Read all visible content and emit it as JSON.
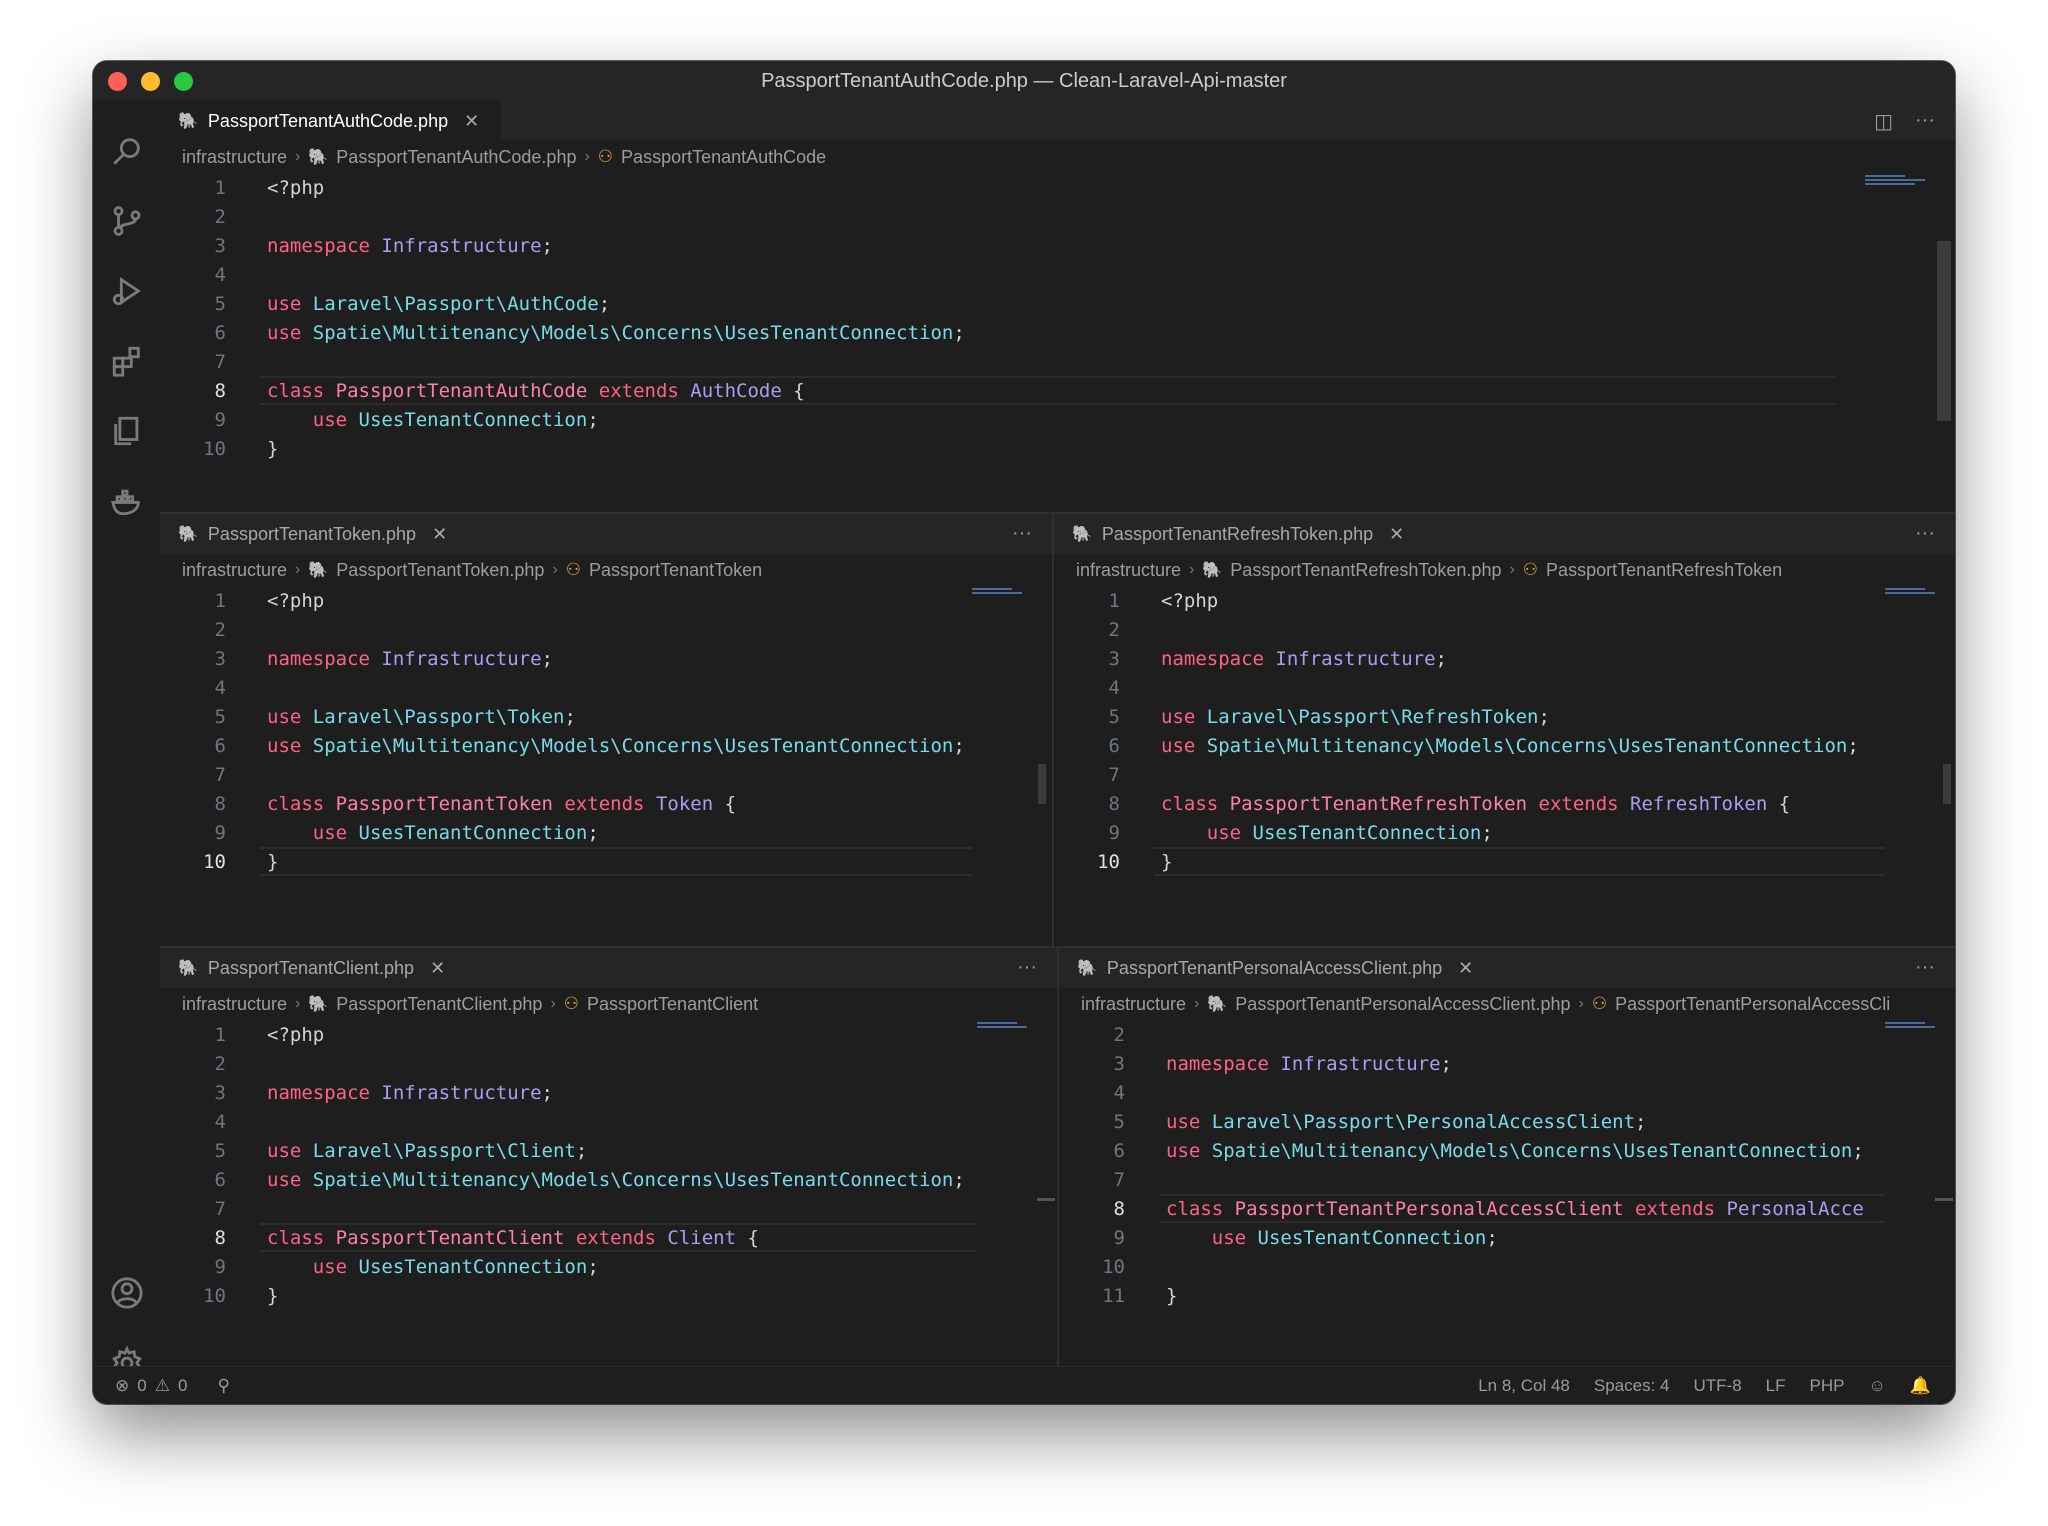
{
  "window": {
    "title": "PassportTenantAuthCode.php — Clean-Laravel-Api-master"
  },
  "activity_bar": [
    "search-icon",
    "source-control-icon",
    "run-debug-icon",
    "extensions-icon",
    "explorer-icon",
    "docker-icon",
    "account-icon",
    "settings-gear-icon"
  ],
  "panes": [
    {
      "id": "top",
      "tab": "PassportTenantAuthCode.php",
      "breadcrumb": {
        "folder": "infrastructure",
        "file": "PassportTenantAuthCode.php",
        "symbol": "PassportTenantAuthCode"
      },
      "lines": [
        {
          "n": "1",
          "tokens": [
            [
              "plain",
              "<?php"
            ]
          ]
        },
        {
          "n": "2",
          "tokens": []
        },
        {
          "n": "3",
          "tokens": [
            [
              "kw",
              "namespace "
            ],
            [
              "ns",
              "Infrastructure"
            ],
            [
              "plain",
              ";"
            ]
          ]
        },
        {
          "n": "4",
          "tokens": []
        },
        {
          "n": "5",
          "tokens": [
            [
              "kw",
              "use "
            ],
            [
              "cls",
              "Laravel\\Passport\\AuthCode"
            ],
            [
              "plain",
              ";"
            ]
          ]
        },
        {
          "n": "6",
          "tokens": [
            [
              "kw",
              "use "
            ],
            [
              "cls",
              "Spatie\\Multitenancy\\Models\\Concerns\\UsesTenantConnection"
            ],
            [
              "plain",
              ";"
            ]
          ]
        },
        {
          "n": "7",
          "tokens": []
        },
        {
          "n": "8",
          "current": true,
          "tokens": [
            [
              "kw",
              "class "
            ],
            [
              "name",
              "PassportTenantAuthCode "
            ],
            [
              "kw",
              "extends "
            ],
            [
              "ext",
              "AuthCode "
            ],
            [
              "plain",
              "{"
            ]
          ]
        },
        {
          "n": "9",
          "tokens": [
            [
              "plain",
              "    "
            ],
            [
              "kw",
              "use "
            ],
            [
              "cls",
              "UsesTenantConnection"
            ],
            [
              "plain",
              ";"
            ]
          ]
        },
        {
          "n": "10",
          "tokens": [
            [
              "plain",
              "}"
            ]
          ]
        }
      ]
    },
    {
      "id": "mid-left",
      "tab": "PassportTenantToken.php",
      "breadcrumb": {
        "folder": "infrastructure",
        "file": "PassportTenantToken.php",
        "symbol": "PassportTenantToken"
      },
      "lines": [
        {
          "n": "1",
          "tokens": [
            [
              "plain",
              "<?php"
            ]
          ]
        },
        {
          "n": "2",
          "tokens": []
        },
        {
          "n": "3",
          "tokens": [
            [
              "kw",
              "namespace "
            ],
            [
              "ns",
              "Infrastructure"
            ],
            [
              "plain",
              ";"
            ]
          ]
        },
        {
          "n": "4",
          "tokens": []
        },
        {
          "n": "5",
          "tokens": [
            [
              "kw",
              "use "
            ],
            [
              "cls",
              "Laravel\\Passport\\Token"
            ],
            [
              "plain",
              ";"
            ]
          ]
        },
        {
          "n": "6",
          "tokens": [
            [
              "kw",
              "use "
            ],
            [
              "cls",
              "Spatie\\Multitenancy\\Models\\Concerns\\UsesTenantConnection"
            ],
            [
              "plain",
              ";"
            ]
          ]
        },
        {
          "n": "7",
          "tokens": []
        },
        {
          "n": "8",
          "tokens": [
            [
              "kw",
              "class "
            ],
            [
              "name",
              "PassportTenantToken "
            ],
            [
              "kw",
              "extends "
            ],
            [
              "ext",
              "Token "
            ],
            [
              "plain",
              "{"
            ]
          ]
        },
        {
          "n": "9",
          "tokens": [
            [
              "plain",
              "    "
            ],
            [
              "kw",
              "use "
            ],
            [
              "cls",
              "UsesTenantConnection"
            ],
            [
              "plain",
              ";"
            ]
          ]
        },
        {
          "n": "10",
          "current": true,
          "tokens": [
            [
              "plain",
              "}"
            ]
          ]
        }
      ]
    },
    {
      "id": "mid-right",
      "tab": "PassportTenantRefreshToken.php",
      "breadcrumb": {
        "folder": "infrastructure",
        "file": "PassportTenantRefreshToken.php",
        "symbol": "PassportTenantRefreshToken"
      },
      "lines": [
        {
          "n": "1",
          "tokens": [
            [
              "plain",
              "<?php"
            ]
          ]
        },
        {
          "n": "2",
          "tokens": []
        },
        {
          "n": "3",
          "tokens": [
            [
              "kw",
              "namespace "
            ],
            [
              "ns",
              "Infrastructure"
            ],
            [
              "plain",
              ";"
            ]
          ]
        },
        {
          "n": "4",
          "tokens": []
        },
        {
          "n": "5",
          "tokens": [
            [
              "kw",
              "use "
            ],
            [
              "cls",
              "Laravel\\Passport\\RefreshToken"
            ],
            [
              "plain",
              ";"
            ]
          ]
        },
        {
          "n": "6",
          "tokens": [
            [
              "kw",
              "use "
            ],
            [
              "cls",
              "Spatie\\Multitenancy\\Models\\Concerns\\UsesTenantConnection"
            ],
            [
              "plain",
              ";"
            ]
          ]
        },
        {
          "n": "7",
          "tokens": []
        },
        {
          "n": "8",
          "tokens": [
            [
              "kw",
              "class "
            ],
            [
              "name",
              "PassportTenantRefreshToken "
            ],
            [
              "kw",
              "extends "
            ],
            [
              "ext",
              "RefreshToken "
            ],
            [
              "plain",
              "{"
            ]
          ]
        },
        {
          "n": "9",
          "tokens": [
            [
              "plain",
              "    "
            ],
            [
              "kw",
              "use "
            ],
            [
              "cls",
              "UsesTenantConnection"
            ],
            [
              "plain",
              ";"
            ]
          ]
        },
        {
          "n": "10",
          "current": true,
          "tokens": [
            [
              "plain",
              "}"
            ]
          ]
        }
      ]
    },
    {
      "id": "bot-left",
      "tab": "PassportTenantClient.php",
      "breadcrumb": {
        "folder": "infrastructure",
        "file": "PassportTenantClient.php",
        "symbol": "PassportTenantClient"
      },
      "lines": [
        {
          "n": "1",
          "tokens": [
            [
              "plain",
              "<?php"
            ]
          ]
        },
        {
          "n": "2",
          "tokens": []
        },
        {
          "n": "3",
          "tokens": [
            [
              "kw",
              "namespace "
            ],
            [
              "ns",
              "Infrastructure"
            ],
            [
              "plain",
              ";"
            ]
          ]
        },
        {
          "n": "4",
          "tokens": []
        },
        {
          "n": "5",
          "tokens": [
            [
              "kw",
              "use "
            ],
            [
              "cls",
              "Laravel\\Passport\\Client"
            ],
            [
              "plain",
              ";"
            ]
          ]
        },
        {
          "n": "6",
          "tokens": [
            [
              "kw",
              "use "
            ],
            [
              "cls",
              "Spatie\\Multitenancy\\Models\\Concerns\\UsesTenantConnection"
            ],
            [
              "plain",
              ";"
            ]
          ]
        },
        {
          "n": "7",
          "tokens": []
        },
        {
          "n": "8",
          "current": true,
          "tokens": [
            [
              "kw",
              "class "
            ],
            [
              "name",
              "PassportTenantClient "
            ],
            [
              "kw",
              "extends "
            ],
            [
              "ext",
              "Client "
            ],
            [
              "plain",
              "{"
            ]
          ]
        },
        {
          "n": "9",
          "tokens": [
            [
              "plain",
              "    "
            ],
            [
              "kw",
              "use "
            ],
            [
              "cls",
              "UsesTenantConnection"
            ],
            [
              "plain",
              ";"
            ]
          ]
        },
        {
          "n": "10",
          "tokens": [
            [
              "plain",
              "}"
            ]
          ]
        }
      ]
    },
    {
      "id": "bot-right",
      "tab": "PassportTenantPersonalAccessClient.php",
      "breadcrumb": {
        "folder": "infrastructure",
        "file": "PassportTenantPersonalAccessClient.php",
        "symbol": "PassportTenantPersonalAccessCli"
      },
      "lines": [
        {
          "n": "2",
          "tokens": []
        },
        {
          "n": "3",
          "tokens": [
            [
              "kw",
              "namespace "
            ],
            [
              "ns",
              "Infrastructure"
            ],
            [
              "plain",
              ";"
            ]
          ]
        },
        {
          "n": "4",
          "tokens": []
        },
        {
          "n": "5",
          "tokens": [
            [
              "kw",
              "use "
            ],
            [
              "cls",
              "Laravel\\Passport\\PersonalAccessClient"
            ],
            [
              "plain",
              ";"
            ]
          ]
        },
        {
          "n": "6",
          "tokens": [
            [
              "kw",
              "use "
            ],
            [
              "cls",
              "Spatie\\Multitenancy\\Models\\Concerns\\UsesTenantConnection"
            ],
            [
              "plain",
              ";"
            ]
          ]
        },
        {
          "n": "7",
          "tokens": []
        },
        {
          "n": "8",
          "current": true,
          "tokens": [
            [
              "kw",
              "class "
            ],
            [
              "name",
              "PassportTenantPersonalAccessClient "
            ],
            [
              "kw",
              "extends "
            ],
            [
              "ext",
              "PersonalAcce"
            ]
          ]
        },
        {
          "n": "9",
          "tokens": [
            [
              "plain",
              "    "
            ],
            [
              "kw",
              "use "
            ],
            [
              "cls",
              "UsesTenantConnection"
            ],
            [
              "plain",
              ";"
            ]
          ]
        },
        {
          "n": "10",
          "tokens": []
        },
        {
          "n": "11",
          "tokens": [
            [
              "plain",
              "}"
            ]
          ]
        }
      ]
    }
  ],
  "tab_actions": {
    "split": "split-editor-icon",
    "more": "···"
  },
  "status": {
    "errors": "0",
    "warnings": "0",
    "position": "Ln 8, Col 48",
    "spaces": "Spaces: 4",
    "encoding": "UTF-8",
    "eol": "LF",
    "language": "PHP"
  },
  "colors": {
    "keyword": "#ff6188",
    "namespace": "#ab9df2",
    "class_ref": "#78dce8",
    "class_name": "#ff7eb0",
    "background": "#1e1e1e"
  }
}
